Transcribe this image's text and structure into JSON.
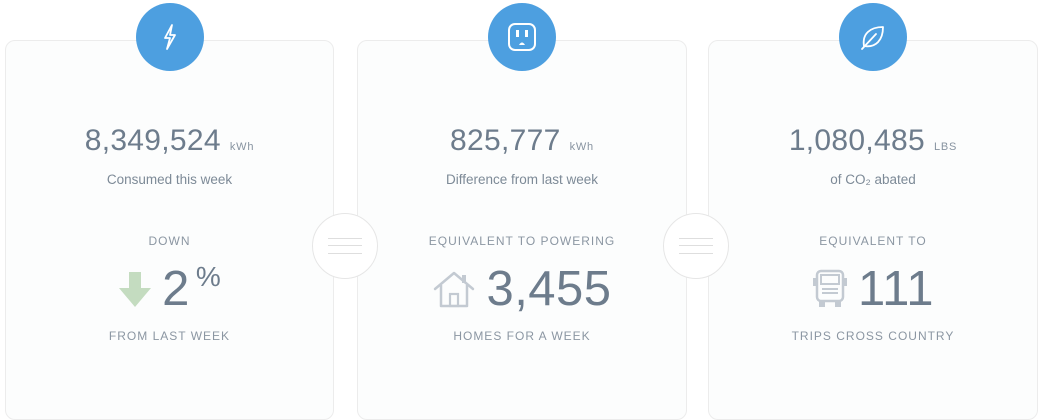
{
  "cards": [
    {
      "icon": "lightning-bolt-icon",
      "value": "8,349,524",
      "unit": "kWh",
      "caption": "Consumed this week",
      "top_label": "DOWN",
      "stat_icon": "down-arrow-icon",
      "stat_value": "2",
      "stat_suffix": "%",
      "bottom_label": "FROM LAST WEEK"
    },
    {
      "icon": "power-outlet-icon",
      "value": "825,777",
      "unit": "kWh",
      "caption": "Difference from last week",
      "top_label": "EQUIVALENT TO POWERING",
      "stat_icon": "house-icon",
      "stat_value": "3,455",
      "bottom_label": "HOMES FOR A WEEK"
    },
    {
      "icon": "leaf-icon",
      "value": "1,080,485",
      "unit": "LBS",
      "caption": "of CO₂ abated",
      "top_label": "EQUIVALENT TO",
      "stat_icon": "truck-icon",
      "stat_value": "111",
      "bottom_label": "TRIPS CROSS COUNTRY"
    }
  ],
  "colors": {
    "accent": "#4d9fe0",
    "text": "#6d7c8c",
    "down_arrow": "#c4dcc0",
    "icon_gray": "#c3cad2"
  }
}
